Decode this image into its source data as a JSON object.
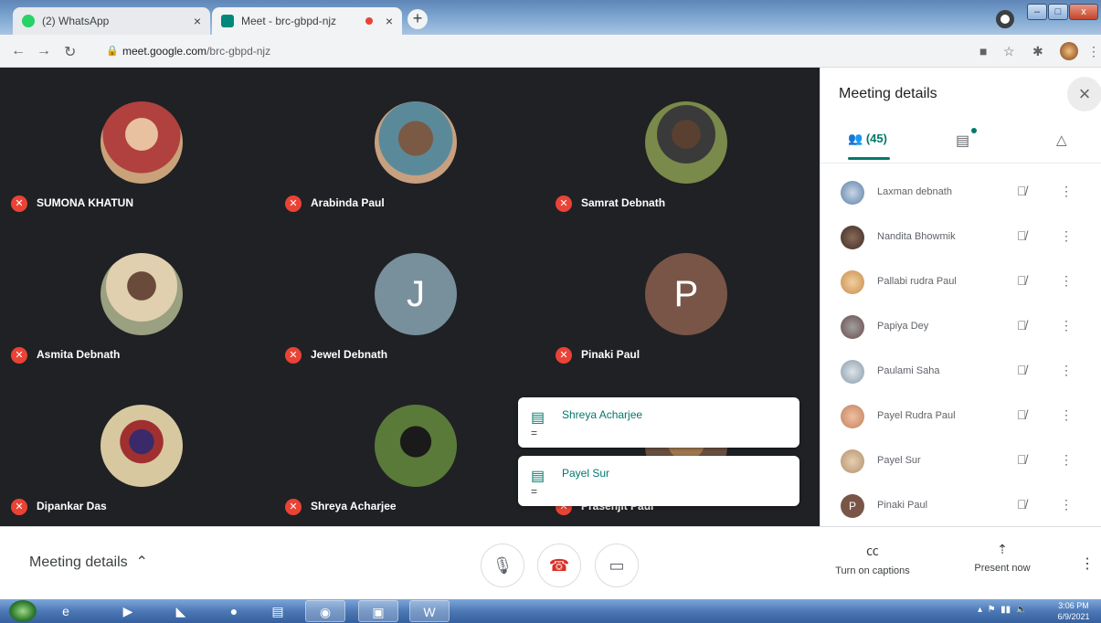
{
  "browser": {
    "tabs": [
      {
        "title": "(2) WhatsApp",
        "close": "×",
        "active": false,
        "favicon_color": "#25d366"
      },
      {
        "title": "Meet - brc-gbpd-njz",
        "close": "×",
        "active": true,
        "favicon_color": "#00897b"
      }
    ],
    "new_tab": "+",
    "url_host": "meet.google.com",
    "url_path": "/brc-gbpd-njz",
    "window_buttons": {
      "minimize": "–",
      "maximize": "□",
      "close": "x"
    }
  },
  "tiles": [
    {
      "name": "SUMONA KHATUN",
      "avatar": "photo",
      "color": "#b0413e"
    },
    {
      "name": "Arabinda Paul",
      "avatar": "photo",
      "color": "#6a5a4a"
    },
    {
      "name": "Samrat Debnath",
      "avatar": "photo",
      "color": "#5c6b3e"
    },
    {
      "name": "Asmita Debnath",
      "avatar": "photo",
      "color": "#9a7a5a"
    },
    {
      "name": "Jewel Debnath",
      "avatar": "J",
      "color": "#78909c"
    },
    {
      "name": "Pinaki Paul",
      "avatar": "P",
      "color": "#795548"
    },
    {
      "name": "Dipankar Das",
      "avatar": "photo",
      "color": "#8a6a4a"
    },
    {
      "name": "Shreya Acharjee",
      "avatar": "photo",
      "color": "#4e6b3a"
    },
    {
      "name": "Prasenjit Paul",
      "avatar": "photo",
      "color": "#a07850"
    }
  ],
  "toasts": [
    {
      "sender": "Shreya Acharjee",
      "message": "="
    },
    {
      "sender": "Payel Sur",
      "message": "="
    }
  ],
  "panel": {
    "title": "Meeting details",
    "close": "×",
    "people_count": "(45)",
    "participants": [
      {
        "name": "Laxman debnath",
        "avatar": "photo",
        "color": "#5b7fa6"
      },
      {
        "name": "Nandita Bhowmik",
        "avatar": "photo",
        "color": "#3e2c24"
      },
      {
        "name": "Pallabi rudra Paul",
        "avatar": "photo",
        "color": "#c98b4a"
      },
      {
        "name": "Papiya Dey",
        "avatar": "photo",
        "color": "#6a4a4a"
      },
      {
        "name": "Paulami Saha",
        "avatar": "photo",
        "color": "#8899aa"
      },
      {
        "name": "Payel Rudra Paul",
        "avatar": "photo",
        "color": "#c08060"
      },
      {
        "name": "Payel Sur",
        "avatar": "photo",
        "color": "#b09070"
      },
      {
        "name": "Pinaki Paul",
        "avatar": "P",
        "color": "#795548"
      }
    ]
  },
  "bottombar": {
    "meeting_details": "Meeting details",
    "captions_label": "Turn on captions",
    "present_label": "Present now"
  },
  "taskbar": {
    "time": "3:06 PM",
    "date": "6/9/2021"
  },
  "icons": {
    "mute": "mic-off-icon",
    "mic": "mic-icon",
    "hangup": "hangup-icon",
    "camera": "camera-icon",
    "captions": "cc-icon",
    "present": "present-icon",
    "chat": "chat-icon"
  }
}
